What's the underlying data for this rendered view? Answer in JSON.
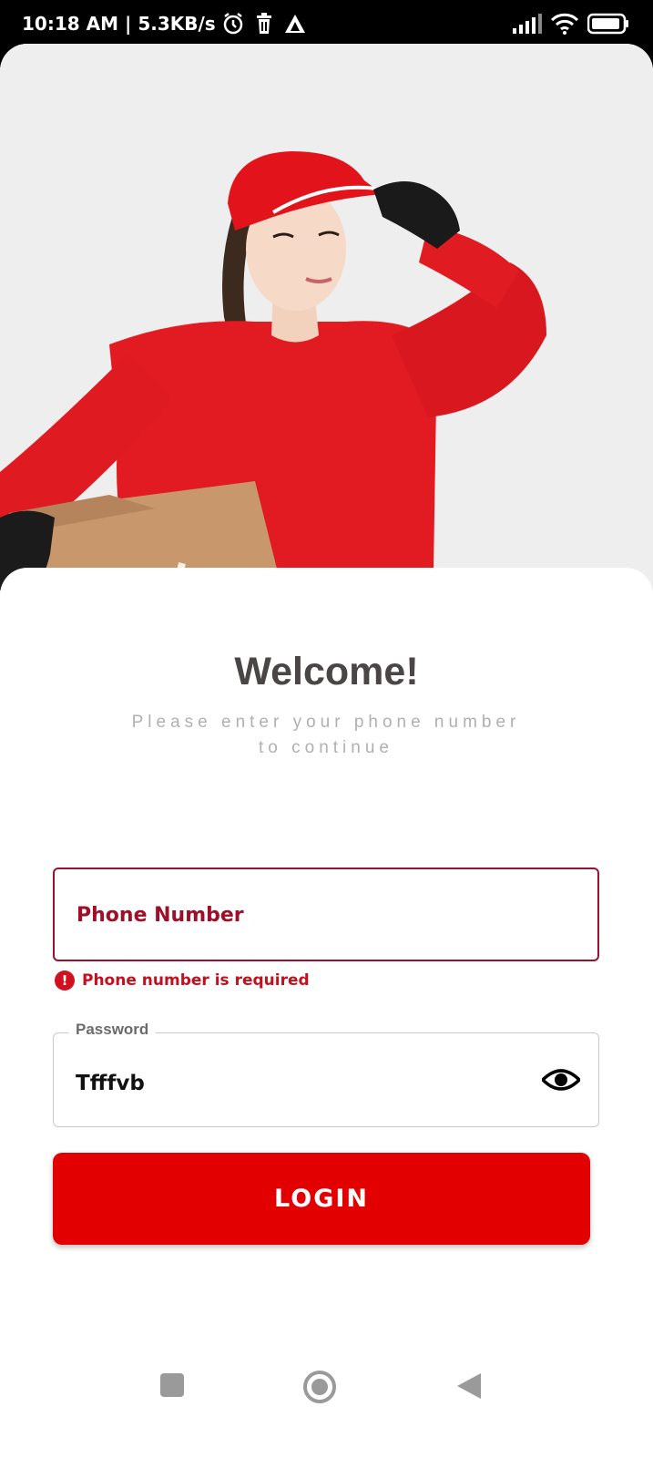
{
  "status_bar": {
    "time": "10:18 AM",
    "separator": "|",
    "speed": "5.3KB/s",
    "icons": [
      "alarm-icon",
      "trash-icon",
      "app-notification-icon",
      "signal-icon",
      "wifi-icon",
      "battery-icon"
    ]
  },
  "hero": {
    "image_description_icon": "delivery-person-illustration"
  },
  "login": {
    "title": "Welcome!",
    "subtitle_line1": "Please enter your phone number",
    "subtitle_line2": "to continue",
    "phone_label": "Phone Number",
    "phone_error": "Phone number is required",
    "password_label": "Password",
    "password_value": "Tfffvb",
    "button_label": "LOGIN"
  },
  "colors": {
    "primary": "#e30000",
    "error": "#c40f1f",
    "phone_border": "#9a1030"
  }
}
